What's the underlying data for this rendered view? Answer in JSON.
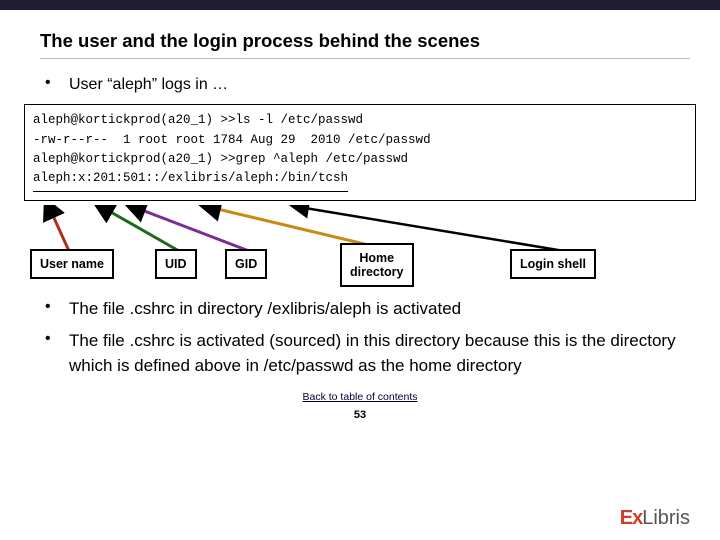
{
  "title": "The user and the login process behind the scenes",
  "bullet1": "User “aleph” logs in …",
  "code": {
    "l1": "aleph@kortickprod(a20_1) >>ls -l /etc/passwd",
    "l2": "-rw-r--r--  1 root root 1784 Aug 29  2010 /etc/passwd",
    "l3": "aleph@kortickprod(a20_1) >>grep ^aleph /etc/passwd",
    "l4": "aleph:x:201:501::/exlibris/aleph:/bin/tcsh"
  },
  "labels": {
    "username": "User name",
    "uid": "UID",
    "gid": "GID",
    "home": "Home\ndirectory",
    "shell": "Login shell"
  },
  "bullet2": "The file .cshrc in directory /exlibris/aleph is activated",
  "bullet3": "The file .cshrc is activated (sourced) in this directory because this is the directory which is defined above in /etc/passwd as the home directory",
  "link": "Back to table of contents",
  "page": "53",
  "logo": {
    "ex": "Ex",
    "libris": "Libris"
  }
}
